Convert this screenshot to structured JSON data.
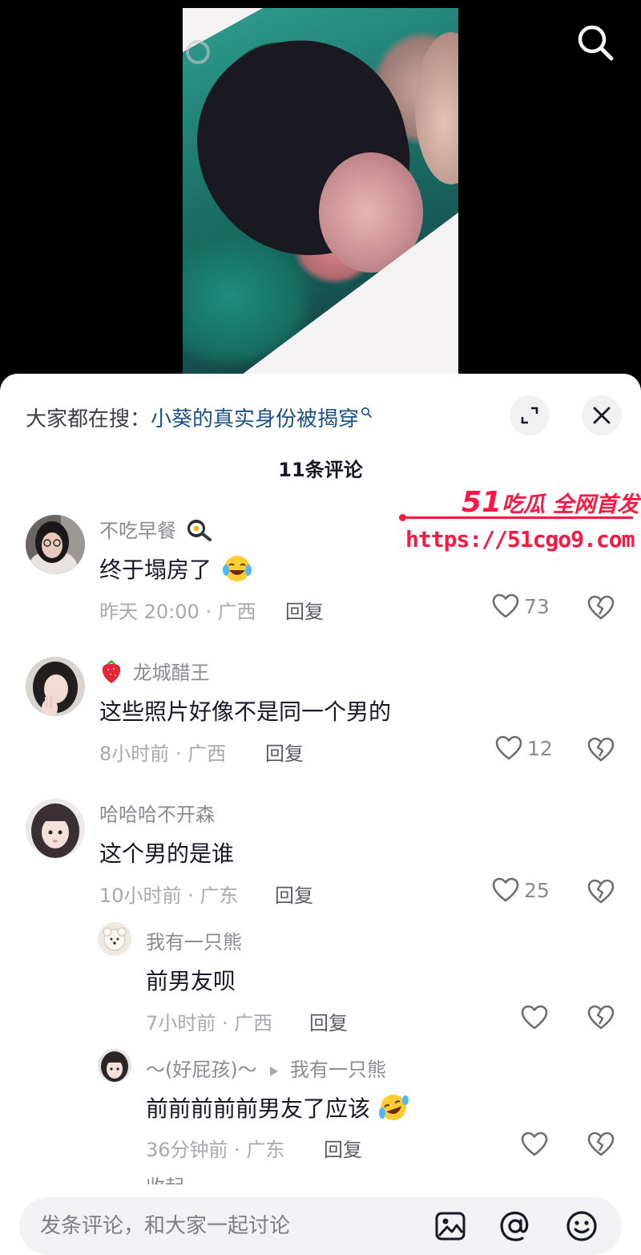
{
  "hot_search": {
    "prefix": "大家都在搜：",
    "keyword": "小葵的真实身份被揭穿"
  },
  "comment_count": "11条评论",
  "watermark": {
    "number": "51",
    "tagline": "吃瓜 全网首发",
    "url": "https://51cgo9.com"
  },
  "comments": [
    {
      "username": "不吃早餐",
      "username_emoji": "frying-pan-egg-icon",
      "text": "终于塌房了",
      "text_emoji": "laughing-crying-face-icon",
      "time_location": "昨天 20:00 · 广西",
      "reply_label": "回复",
      "likes": "73"
    },
    {
      "username": "龙城醋王",
      "username_emoji": "strawberry-icon",
      "text": "这些照片好像不是同一个男的",
      "time_location": "8小时前 · 广西",
      "reply_label": "回复",
      "likes": "12"
    },
    {
      "username": "哈哈哈不开森",
      "text": "这个男的是谁",
      "time_location": "10小时前 · 广东",
      "reply_label": "回复",
      "likes": "25",
      "replies": [
        {
          "username": "我有一只熊",
          "text": "前男友呗",
          "time_location": "7小时前 · 广西",
          "reply_label": "回复"
        },
        {
          "username": "～(好屁孩)～",
          "reply_to": "我有一只熊",
          "text": "前前前前前男友了应该",
          "text_emoji": "rolling-laughing-face-icon",
          "time_location": "36分钟前 · 广东",
          "reply_label": "回复"
        }
      ]
    }
  ],
  "collapse_label": "收起",
  "input": {
    "placeholder": "发条评论，和大家一起讨论"
  },
  "colors": {
    "keyword_blue": "#1a4f84",
    "watermark_red": "#ff1744",
    "meta_gray": "#a8a9ae"
  }
}
